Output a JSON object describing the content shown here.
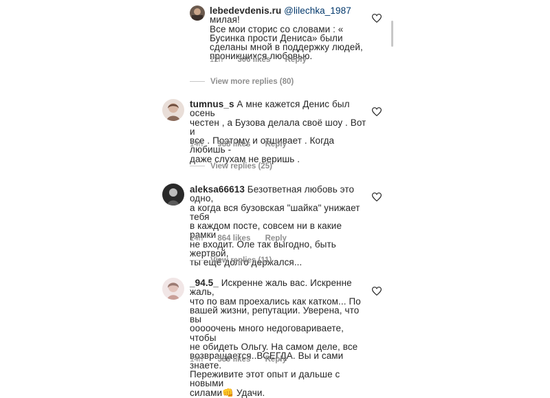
{
  "comments": [
    {
      "username": "lebedevdenis.ru",
      "mention": "@lilechka_1987",
      "text_after_mention": " милая!",
      "lines": [
        "Все мои сторис со словами : «",
        "Бусинка прости Дениса» были",
        "сделаны мной в поддержку людей,",
        "проникшихся любовью."
      ],
      "time": "12h",
      "likes": "306 likes",
      "reply": "Reply",
      "view_replies": "View more replies (80)"
    },
    {
      "username": "tumnus_s",
      "first_line": " А мне кажется Денис был осень",
      "lines": [
        "честен , а Бузова делала своё шоу . Вот и",
        "все . Поэтому и отшивает . Когда любишь -",
        "даже слухам не веришь ."
      ],
      "time": "14h",
      "likes": "988 likes",
      "reply": "Reply",
      "view_replies": "View replies (25)"
    },
    {
      "username": "aleksa66613",
      "first_line": " Безответная любовь это одно,",
      "lines": [
        "а когда вся бузовская \"шайка\" унижает тебя",
        "в каждом посте, совсем ни в какие рамки",
        "не входит. Оле так выгодно, быть жертвой,",
        "ты ещё долго держался..."
      ],
      "time": "14h",
      "likes": "864 likes",
      "reply": "Reply",
      "view_replies": "View replies (11)"
    },
    {
      "username": "_94.5_",
      "first_line": " Искренне жаль вас. Искренне жаль,",
      "lines": [
        "что по вам проехались как катком... По",
        "вашей жизни, репутации. Уверена, что вы",
        "ооооочень много недоговариваете, чтобы",
        "не обидеть Ольгу. На самом деле, все",
        "возвращается..ВСЕГДА. Вы и сами знаете.",
        "Переживите этот опыт и дальше с новыми",
        "силами👊 Удачи."
      ],
      "time": "14h",
      "likes": "589 likes",
      "reply": "Reply"
    }
  ],
  "icons": {
    "like": "heart-outline-icon"
  },
  "colors": {
    "text": "#262626",
    "meta": "#8e8e8e",
    "mention": "#00376b"
  }
}
